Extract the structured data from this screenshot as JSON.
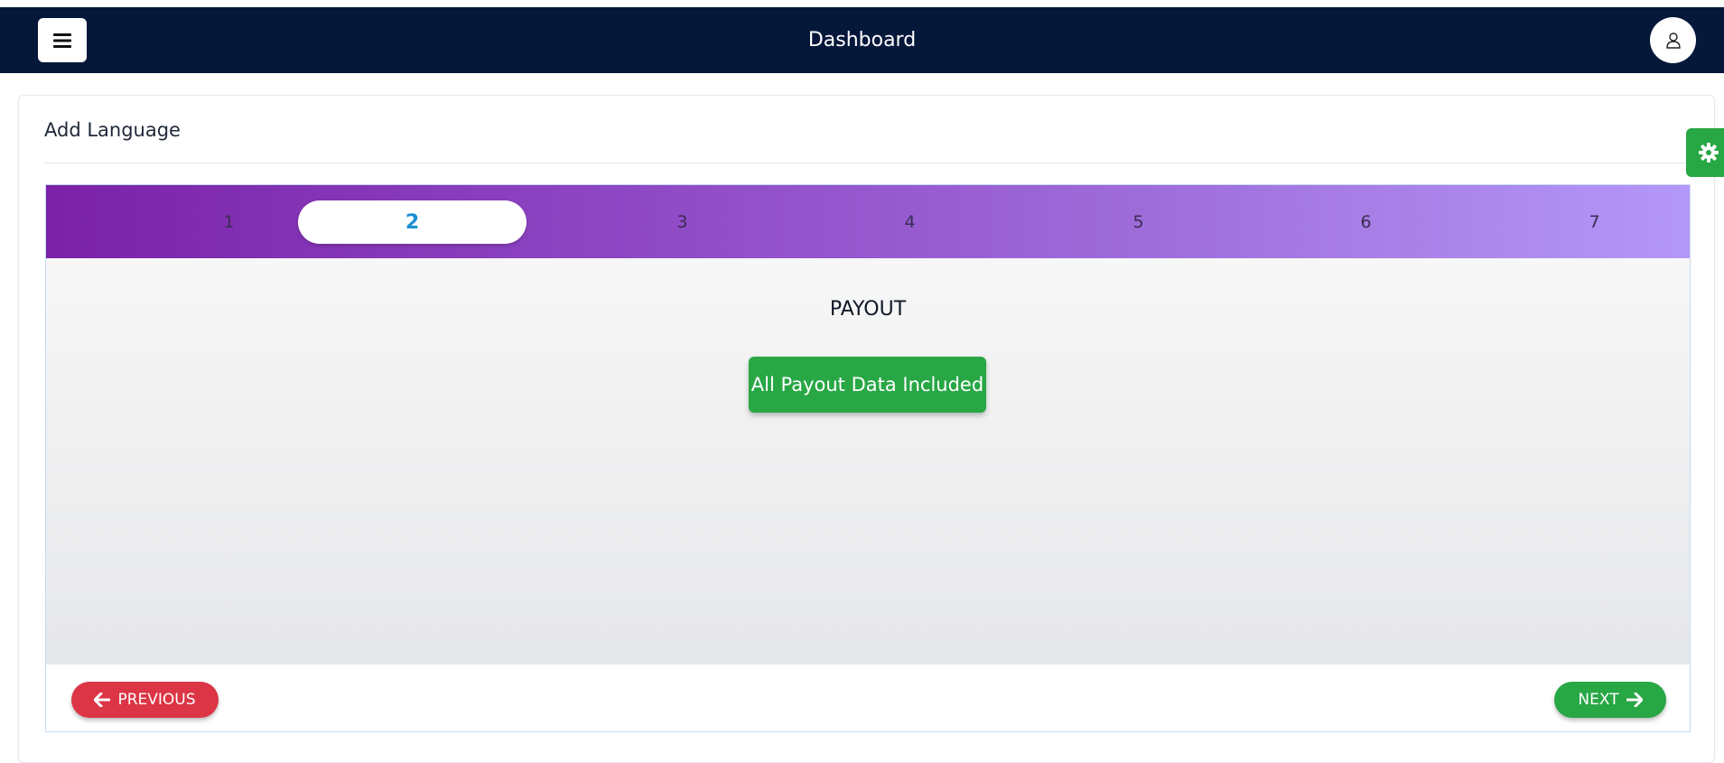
{
  "navbar": {
    "title": "Dashboard",
    "background": "#06183a",
    "menu_icon": "hamburger-icon",
    "user_icon": "user-icon"
  },
  "card": {
    "title": "Add Language"
  },
  "settings": {
    "icon": "gear-icon",
    "color": "#28a745"
  },
  "wizard": {
    "steps": [
      "1",
      "2",
      "3",
      "4",
      "5",
      "6",
      "7"
    ],
    "active_step": "2",
    "section_title": "PAYOUT",
    "payout_button": "All Payout Data Included",
    "previous_label": "PREVIOUS",
    "next_label": "NEXT",
    "colors": {
      "active_step_text": "#1b8fd0",
      "previous": "#dc3545",
      "next": "#28a745",
      "payout": "#28a745"
    }
  }
}
